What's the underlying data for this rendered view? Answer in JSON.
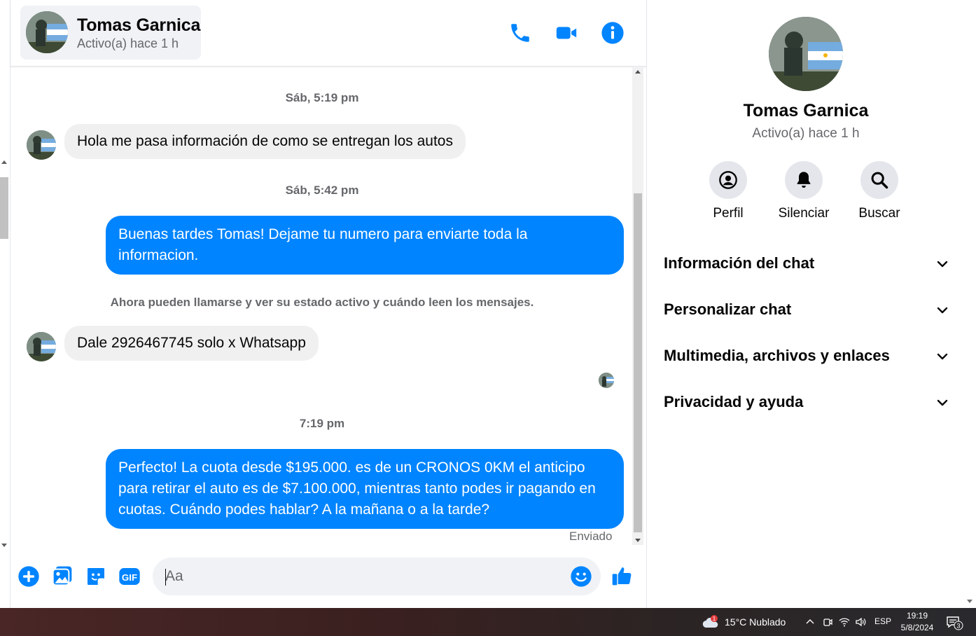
{
  "contact": {
    "name": "Tomas Garnica",
    "status": "Activo(a) hace 1 h"
  },
  "header_icons": [
    "phone-icon",
    "video-camera-icon",
    "info-icon"
  ],
  "messages": [
    {
      "type": "timestamp",
      "text": "Sáb, 5:19 pm"
    },
    {
      "type": "incoming",
      "text": "Hola me pasa información de como se entregan los autos"
    },
    {
      "type": "timestamp",
      "text": "Sáb, 5:42 pm"
    },
    {
      "type": "outgoing",
      "text": "Buenas tardes Tomas! Dejame tu numero para enviarte toda la informacion."
    },
    {
      "type": "system",
      "text": "Ahora pueden llamarse y ver su estado activo y cuándo leen los mensajes."
    },
    {
      "type": "incoming",
      "text": "Dale 2926467745 solo x Whatsapp"
    },
    {
      "type": "timestamp",
      "text": "7:19 pm"
    },
    {
      "type": "outgoing",
      "text": "Perfecto! La cuota desde $195.000. es de un CRONOS 0KM el anticipo para retirar el auto es de $7.100.000, mientras tanto podes ir pagando en cuotas. Cuándo podes hablar? A la mañana o a la tarde?"
    }
  ],
  "sent_status": "Enviado",
  "composer": {
    "placeholder": "Aa",
    "icons": [
      "plus-icon",
      "photo-icon",
      "sticker-icon",
      "gif-icon",
      "emoji-icon",
      "thumbs-up-icon"
    ]
  },
  "panel": {
    "name": "Tomas Garnica",
    "status": "Activo(a) hace 1 h",
    "actions": [
      {
        "label": "Perfil",
        "icon": "profile-icon"
      },
      {
        "label": "Silenciar",
        "icon": "bell-icon"
      },
      {
        "label": "Buscar",
        "icon": "search-icon"
      }
    ],
    "sections": [
      "Información del chat",
      "Personalizar chat",
      "Multimedia, archivos y enlaces",
      "Privacidad y ayuda"
    ]
  },
  "taskbar": {
    "weather": "15°C  Nublado",
    "weather_badge": "1",
    "language": "ESP",
    "time": "19:19",
    "date": "5/8/2024",
    "notification_count": "3"
  },
  "colors": {
    "accent": "#0084ff",
    "incoming_bubble": "#f0f0f0",
    "muted_text": "#65676b"
  }
}
